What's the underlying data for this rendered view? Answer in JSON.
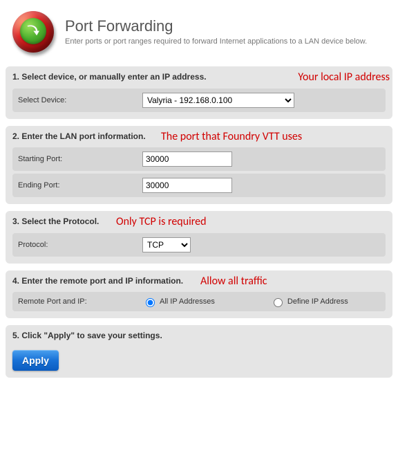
{
  "header": {
    "title": "Port Forwarding",
    "subtitle": "Enter ports or port ranges required to forward Internet applications to a LAN device below."
  },
  "section1": {
    "heading": "1. Select device, or manually enter an IP address.",
    "annotation": "Your local IP address",
    "row_label": "Select Device:",
    "device_selected": "Valyria - 192.168.0.100"
  },
  "section2": {
    "heading": "2. Enter the LAN port information.",
    "annotation": "The port that Foundry VTT uses",
    "start_label": "Starting Port:",
    "start_value": "30000",
    "end_label": "Ending Port:",
    "end_value": "30000"
  },
  "section3": {
    "heading": "3. Select the Protocol.",
    "annotation": "Only TCP is required",
    "row_label": "Protocol:",
    "protocol_selected": "TCP"
  },
  "section4": {
    "heading": "4. Enter the remote port and IP information.",
    "annotation": "Allow all traffic",
    "row_label": "Remote Port and IP:",
    "opt_all": "All IP Addresses",
    "opt_define": "Define IP Address"
  },
  "section5": {
    "heading": "5. Click \"Apply\" to save your settings.",
    "apply_label": "Apply"
  }
}
